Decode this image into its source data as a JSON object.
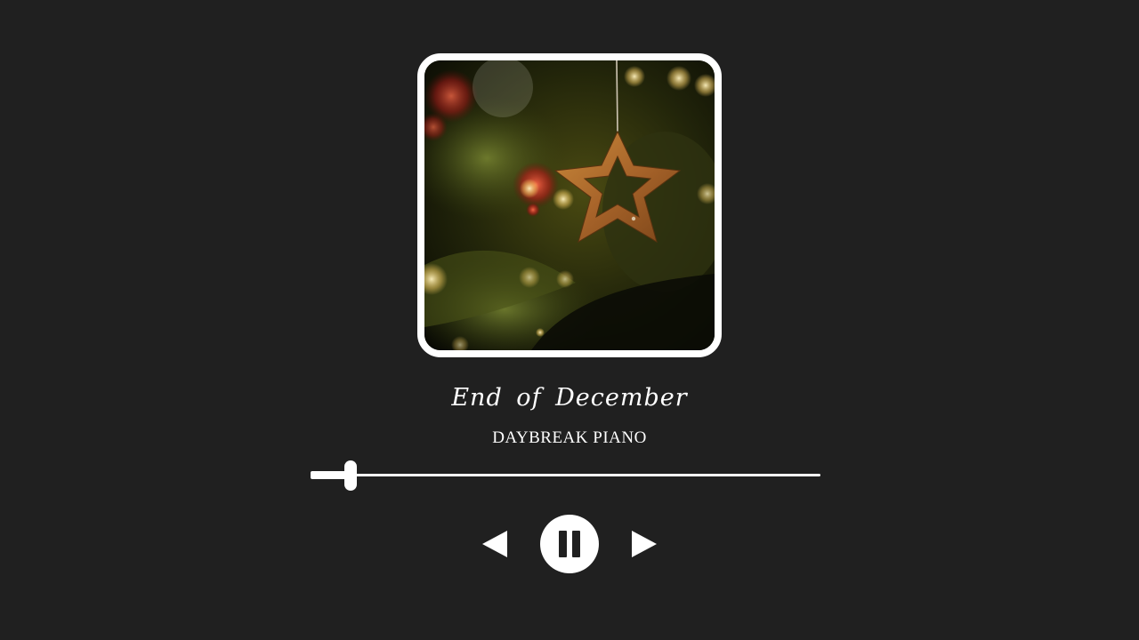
{
  "track": {
    "title": "End of December",
    "artist": "DAYBREAK PIANO"
  },
  "artwork": {
    "subject": "star-ornament-on-christmas-tree"
  },
  "playback": {
    "progress_fraction": 0.078,
    "state": "playing"
  },
  "controls": {
    "prev_icon": "previous-triangle-icon",
    "pause_icon": "pause-icon",
    "next_icon": "next-triangle-icon"
  },
  "colors": {
    "background": "#202020",
    "foreground": "#ffffff"
  }
}
